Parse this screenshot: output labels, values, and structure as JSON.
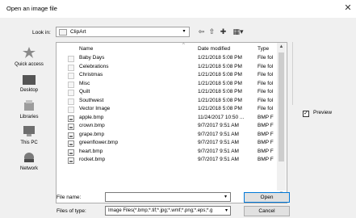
{
  "window": {
    "title": "Open an image file",
    "close_glyph": "✕"
  },
  "toolbar": {
    "look_in_label": "Look in:",
    "look_in_value": "ClipArt",
    "dropdown_glyph": "▾",
    "back_icon": "⇦",
    "up_icon": "⇧",
    "new_folder_icon": "✚",
    "views_icon": "▦▾"
  },
  "places": [
    {
      "label": "Quick access",
      "icon": "star-icon"
    },
    {
      "label": "Desktop",
      "icon": "desktop-icon"
    },
    {
      "label": "Libraries",
      "icon": "libraries-icon"
    },
    {
      "label": "This PC",
      "icon": "computer-icon"
    },
    {
      "label": "Network",
      "icon": "network-icon"
    }
  ],
  "columns": {
    "name": "Name",
    "date": "Date modified",
    "type": "Type"
  },
  "files": [
    {
      "name": "Baby Days",
      "date": "1/21/2018 5:08 PM",
      "type": "File fol",
      "kind": "folder"
    },
    {
      "name": "Celebrations",
      "date": "1/21/2018 5:08 PM",
      "type": "File fol",
      "kind": "folder"
    },
    {
      "name": "Christmas",
      "date": "1/21/2018 5:08 PM",
      "type": "File fol",
      "kind": "folder"
    },
    {
      "name": "Misc",
      "date": "1/21/2018 5:08 PM",
      "type": "File fol",
      "kind": "folder"
    },
    {
      "name": "Quilt",
      "date": "1/21/2018 5:08 PM",
      "type": "File fol",
      "kind": "folder"
    },
    {
      "name": "Southwest",
      "date": "1/21/2018 5:08 PM",
      "type": "File fol",
      "kind": "folder"
    },
    {
      "name": "Vector Image",
      "date": "1/21/2018 5:08 PM",
      "type": "File fol",
      "kind": "folder"
    },
    {
      "name": "apple.bmp",
      "date": "11/24/2017 10:50 ...",
      "type": "BMP F",
      "kind": "bmp"
    },
    {
      "name": "crown.bmp",
      "date": "9/7/2017 9:51 AM",
      "type": "BMP F",
      "kind": "bmp"
    },
    {
      "name": "grape.bmp",
      "date": "9/7/2017 9:51 AM",
      "type": "BMP F",
      "kind": "bmp"
    },
    {
      "name": "greenflower.bmp",
      "date": "9/7/2017 9:51 AM",
      "type": "BMP F",
      "kind": "bmp"
    },
    {
      "name": "heart.bmp",
      "date": "9/7/2017 9:51 AM",
      "type": "BMP F",
      "kind": "bmp"
    },
    {
      "name": "rocket.bmp",
      "date": "9/7/2017 9:51 AM",
      "type": "BMP F",
      "kind": "bmp"
    }
  ],
  "preview": {
    "label": "Preview",
    "checked": true,
    "check_glyph": "✓"
  },
  "footer": {
    "file_name_label": "File name:",
    "file_name_value": "",
    "files_of_type_label": "Files of type:",
    "files_of_type_value": "Image Files(*.bmp;*.tif;*.jpg;*.wmf;*.png;*.eps;*.g",
    "open_label": "Open",
    "cancel_label": "Cancel"
  }
}
